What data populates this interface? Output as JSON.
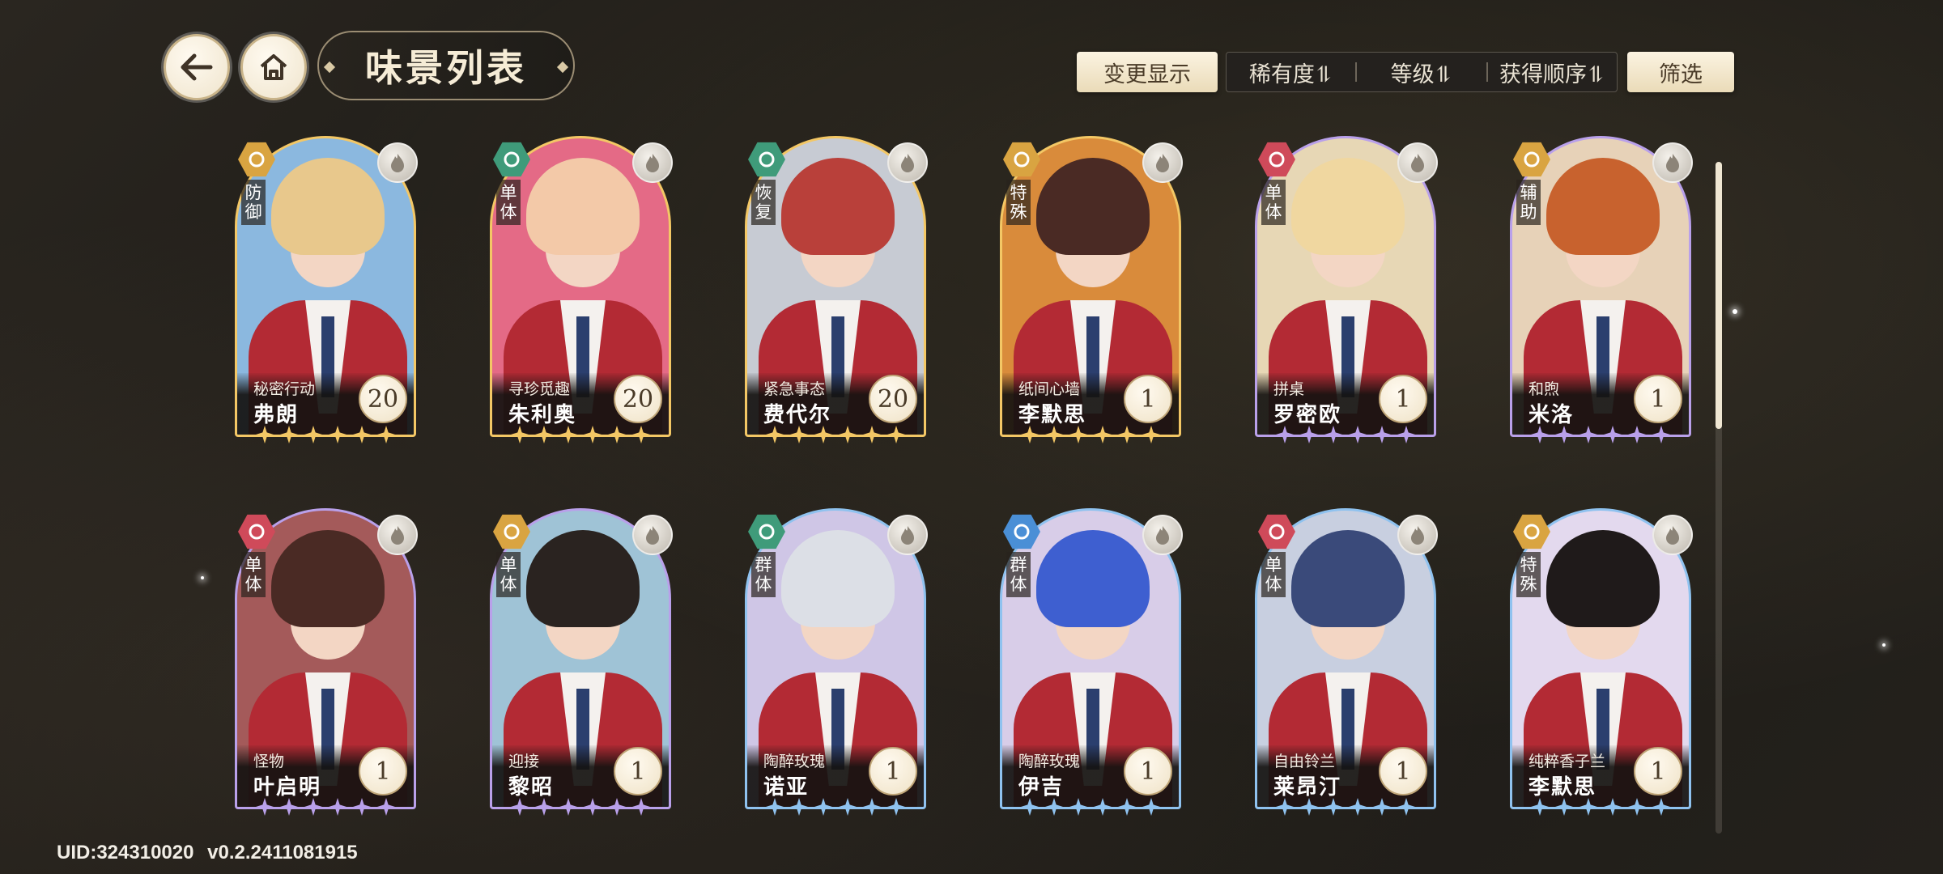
{
  "header": {
    "title": "味景列表",
    "back_icon": "arrow-left-icon",
    "home_icon": "home-icon"
  },
  "toolbar": {
    "change_display_label": "变更显示",
    "sort_options": [
      "稀有度⥮",
      "等级⥮",
      "获得顺序⥮"
    ],
    "filter_label": "筛选"
  },
  "cards": [
    {
      "role": "防御",
      "subtitle": "秘密行动",
      "name": "弗朗",
      "level": "20",
      "rarity": "gold",
      "role_color": "#d9a441",
      "bg": "#8bb8df",
      "hair": "#e8c88c",
      "element_icon": "flame-icon"
    },
    {
      "role": "单体",
      "subtitle": "寻珍觅趣",
      "name": "朱利奥",
      "level": "20",
      "rarity": "gold",
      "role_color": "#3f9b7a",
      "bg": "#e46a86",
      "hair": "#f3c9a8",
      "element_icon": "flame-icon"
    },
    {
      "role": "恢复",
      "subtitle": "紧急事态",
      "name": "费代尔",
      "level": "20",
      "rarity": "gold",
      "role_color": "#3f9b7a",
      "bg": "#c7cbd3",
      "hair": "#b9403a",
      "element_icon": "flame-icon"
    },
    {
      "role": "特殊",
      "subtitle": "纸间心墙",
      "name": "李默思",
      "level": "1",
      "rarity": "gold",
      "role_color": "#d9a441",
      "bg": "#d98b3b",
      "hair": "#4a2a24",
      "element_icon": "flame-icon"
    },
    {
      "role": "单体",
      "subtitle": "拼桌",
      "name": "罗密欧",
      "level": "1",
      "rarity": "purple",
      "role_color": "#cf4a5a",
      "bg": "#e7d7b5",
      "hair": "#f0d7a0",
      "element_icon": "flame-icon"
    },
    {
      "role": "辅助",
      "subtitle": "和煦",
      "name": "米洛",
      "level": "1",
      "rarity": "purple",
      "role_color": "#d9a441",
      "bg": "#e7d2b8",
      "hair": "#c8622e",
      "element_icon": "flame-icon"
    },
    {
      "role": "单体",
      "subtitle": "怪物",
      "name": "叶启明",
      "level": "1",
      "rarity": "purple",
      "role_color": "#cf4a5a",
      "bg": "#a45a5a",
      "hair": "#4a2a24",
      "element_icon": "flame-icon"
    },
    {
      "role": "单体",
      "subtitle": "迎接",
      "name": "黎昭",
      "level": "1",
      "rarity": "purple",
      "role_color": "#d9a441",
      "bg": "#9fc3d6",
      "hair": "#2a2320",
      "element_icon": "flame-icon"
    },
    {
      "role": "群体",
      "subtitle": "陶醉玫瑰",
      "name": "诺亚",
      "level": "1",
      "rarity": "blue",
      "role_color": "#3f9b7a",
      "bg": "#cfc6e6",
      "hair": "#dcdfe6",
      "element_icon": "flame-icon"
    },
    {
      "role": "群体",
      "subtitle": "陶醉玫瑰",
      "name": "伊吉",
      "level": "1",
      "rarity": "blue",
      "role_color": "#4a8fd6",
      "bg": "#d8cde8",
      "hair": "#3e5fd0",
      "element_icon": "flame-icon"
    },
    {
      "role": "单体",
      "subtitle": "自由铃兰",
      "name": "莱昂汀",
      "level": "1",
      "rarity": "blue",
      "role_color": "#cf4a5a",
      "bg": "#c8cfe0",
      "hair": "#3a4a7a",
      "element_icon": "flame-icon"
    },
    {
      "role": "特殊",
      "subtitle": "纯粹香子兰",
      "name": "李默思",
      "level": "1",
      "rarity": "blue",
      "role_color": "#d9a441",
      "bg": "#e3d9ee",
      "hair": "#1f1a1a",
      "element_icon": "flame-icon"
    }
  ],
  "rarity_colors": {
    "gold": "#f3c765",
    "purple": "#b9a0ea",
    "blue": "#8fc2ef"
  },
  "scroll_progress": 0.0,
  "footer": {
    "uid": "UID:324310020",
    "version": "v0.2.2411081915"
  }
}
